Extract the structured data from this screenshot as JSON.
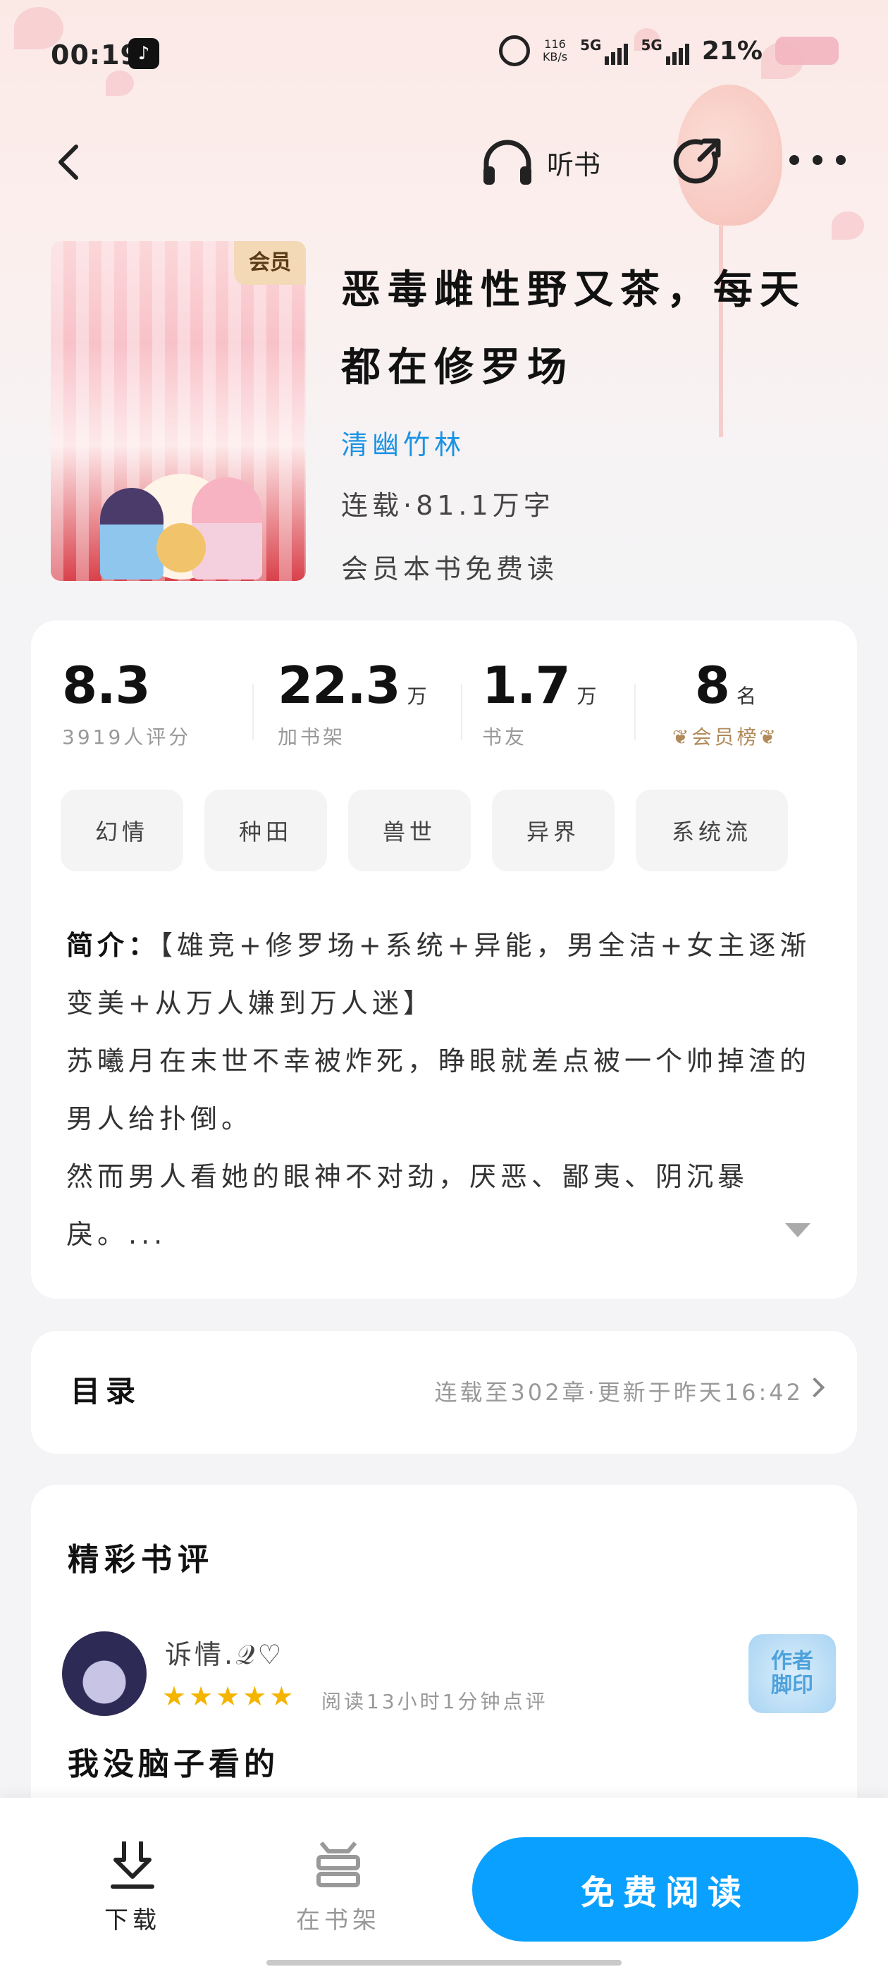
{
  "status_bar": {
    "time": "00:19",
    "speed": "116\nKB/s",
    "net1": "5G",
    "net2": "5G",
    "battery": "21%"
  },
  "nav": {
    "listen_label": "听书"
  },
  "book": {
    "cover_badge": "会员",
    "title": "恶毒雌性野又茶，每天都在修罗场",
    "author": "清幽竹林",
    "meta": "连载·81.1万字",
    "vip_note": "会员本书免费读"
  },
  "stats": [
    {
      "value": "8.3",
      "unit": "",
      "label": "3919人评分"
    },
    {
      "value": "22.3",
      "unit": "万",
      "label": "加书架"
    },
    {
      "value": "1.7",
      "unit": "万",
      "label": "书友"
    },
    {
      "value": "8",
      "unit": "名",
      "label": "会员榜"
    }
  ],
  "tags": [
    "幻情",
    "种田",
    "兽世",
    "异界",
    "系统流"
  ],
  "intro": {
    "lead": "简介：",
    "line1": "【雄竞+修罗场+系统+异能，男全洁+女主逐渐变美+从万人嫌到万人迷】",
    "line2": "苏曦月在末世不幸被炸死，睁眼就差点被一个帅掉渣的男人给扑倒。",
    "line3": "然而男人看她的眼神不对劲，厌恶、鄙夷、阴沉暴戾。..."
  },
  "toc": {
    "title": "目录",
    "status": "连载至302章·更新于昨天16:42"
  },
  "reviews": {
    "title": "精彩书评",
    "items": [
      {
        "user": "诉情.𝒬♡",
        "rating": 5,
        "meta": "阅读13小时1分钟点评",
        "badge": "作者\n脚印",
        "text": "我没脑子看的"
      }
    ]
  },
  "bottom_bar": {
    "download_label": "下载",
    "shelf_label": "在书架",
    "read_label": "免费阅读"
  },
  "colors": {
    "accent": "#0aa0ff",
    "author_link": "#1a93e6",
    "star": "#f4b400"
  }
}
